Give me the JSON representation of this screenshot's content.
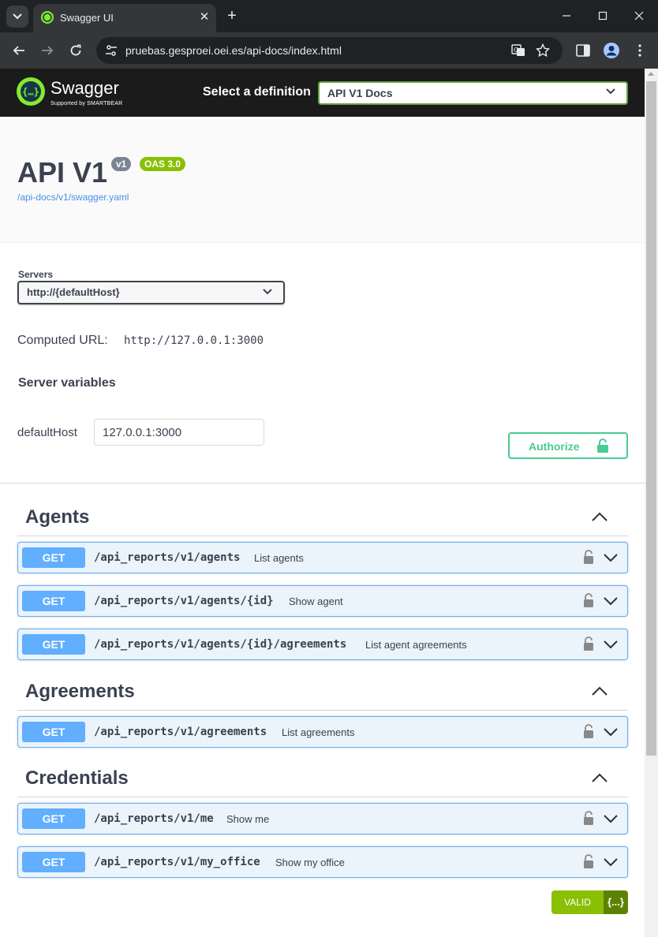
{
  "browser": {
    "tab_title": "Swagger UI",
    "url": "pruebas.gesproei.oei.es/api-docs/index.html"
  },
  "topbar": {
    "logo_text": "Swagger",
    "logo_sub": "Supported by SMARTBEAR",
    "select_label": "Select a definition",
    "definition": "API V1 Docs"
  },
  "info": {
    "title": "API V1",
    "version": "v1",
    "oas": "OAS 3.0",
    "spec_link": "/api-docs/v1/swagger.yaml"
  },
  "servers": {
    "label": "Servers",
    "selected": "http://{defaultHost}",
    "computed_label": "Computed URL:",
    "computed_url": "http://127.0.0.1:3000",
    "variables_title": "Server variables",
    "variable_name": "defaultHost",
    "variable_value": "127.0.0.1:3000"
  },
  "authorize_label": "Authorize",
  "tags": [
    {
      "name": "Agents",
      "operations": [
        {
          "method": "GET",
          "path": "/api_reports/v1/agents",
          "summary": "List agents"
        },
        {
          "method": "GET",
          "path": "/api_reports/v1/agents/{id}",
          "summary": "Show agent"
        },
        {
          "method": "GET",
          "path": "/api_reports/v1/agents/{id}/agreements",
          "summary": "List agent agreements"
        }
      ]
    },
    {
      "name": "Agreements",
      "operations": [
        {
          "method": "GET",
          "path": "/api_reports/v1/agreements",
          "summary": "List agreements"
        }
      ]
    },
    {
      "name": "Credentials",
      "operations": [
        {
          "method": "GET",
          "path": "/api_reports/v1/me",
          "summary": "Show me"
        },
        {
          "method": "GET",
          "path": "/api_reports/v1/my_office",
          "summary": "Show my office"
        }
      ]
    }
  ],
  "validator": {
    "label": "VALID",
    "icon_text": "{...}"
  },
  "colors": {
    "get": "#61affe",
    "oas": "#89bf04",
    "authorize": "#49cc90",
    "topbar": "#1b1b1b"
  }
}
